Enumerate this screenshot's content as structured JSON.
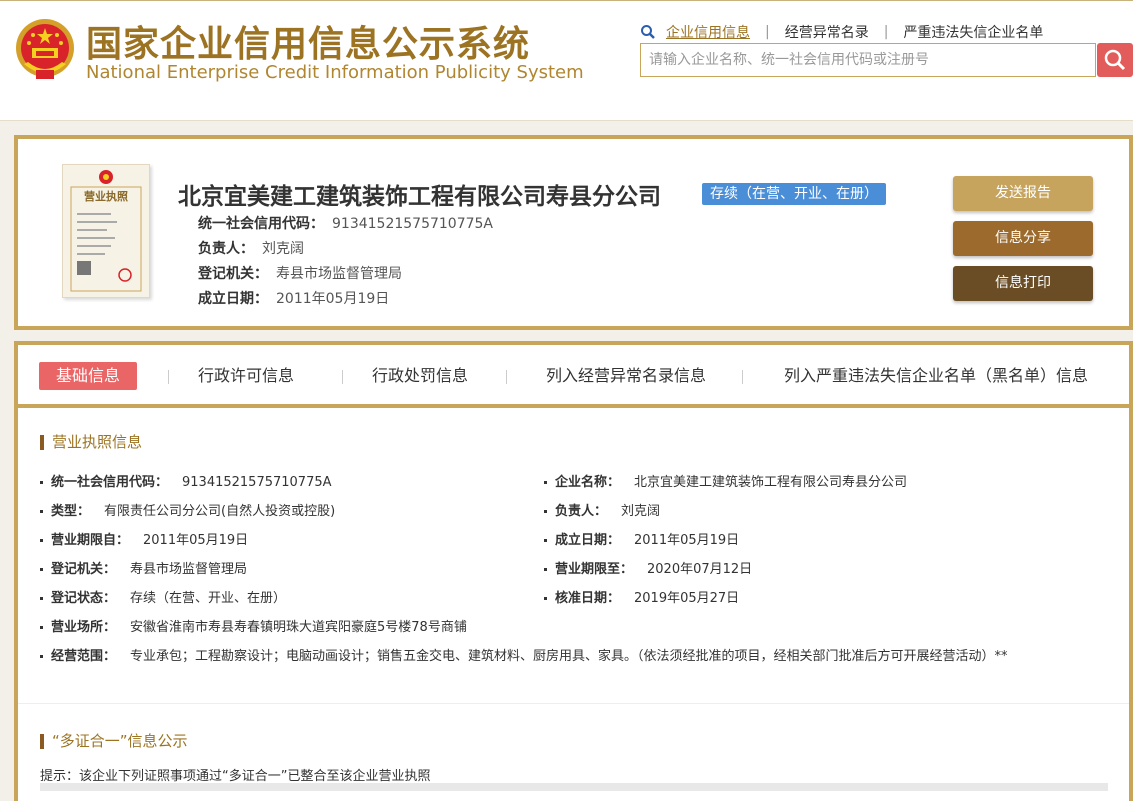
{
  "header": {
    "title_cn": "国家企业信用信息公示系统",
    "title_en": "National Enterprise Credit Information Publicity System",
    "links": [
      "企业信用信息",
      "经营异常名录",
      "严重违法失信企业名单"
    ],
    "search_placeholder": "请输入企业名称、统一社会信用代码或注册号",
    "colors": {
      "brand": "#9c7322",
      "search_button": "#e35c5c"
    }
  },
  "company": {
    "name": "北京宜美建工建筑装饰工程有限公司寿县分公司",
    "status": "存续（在营、开业、在册）",
    "fields": [
      {
        "label": "统一社会信用代码：",
        "value": "91341521575710775A"
      },
      {
        "label": "负责人：",
        "value": "刘克阔"
      },
      {
        "label": "登记机关：",
        "value": "寿县市场监督管理局"
      },
      {
        "label": "成立日期：",
        "value": "2011年05月19日"
      }
    ],
    "license_icon_label": "营业执照",
    "buttons": {
      "send_report": "发送报告",
      "share": "信息分享",
      "print": "信息打印"
    }
  },
  "tabs": [
    "基础信息",
    "行政许可信息",
    "行政处罚信息",
    "列入经营异常名录信息",
    "列入严重违法失信企业名单（黑名单）信息"
  ],
  "license_section": {
    "title": "营业执照信息",
    "left": [
      {
        "label": "统一社会信用代码：",
        "value": "91341521575710775A"
      },
      {
        "label": "类型：",
        "value": "有限责任公司分公司(自然人投资或控股)"
      },
      {
        "label": "营业期限自：",
        "value": "2011年05月19日"
      },
      {
        "label": "登记机关：",
        "value": "寿县市场监督管理局"
      },
      {
        "label": "登记状态：",
        "value": "存续（在营、开业、在册）"
      }
    ],
    "right": [
      {
        "label": "企业名称：",
        "value": "北京宜美建工建筑装饰工程有限公司寿县分公司"
      },
      {
        "label": "负责人：",
        "value": "刘克阔"
      },
      {
        "label": "成立日期：",
        "value": "2011年05月19日"
      },
      {
        "label": "营业期限至：",
        "value": "2020年07月12日"
      },
      {
        "label": "核准日期：",
        "value": "2019年05月27日"
      }
    ],
    "address": {
      "label": "营业场所：",
      "value": "安徽省淮南市寿县寿春镇明珠大道宾阳豪庭5号楼78号商铺"
    },
    "scope": {
      "label": "经营范围：",
      "value": "专业承包；工程勘察设计；电脑动画设计；销售五金交电、建筑材料、厨房用具、家具。（依法须经批准的项目，经相关部门批准后方可开展经营活动）**"
    }
  },
  "multi_cert": {
    "title": "“多证合一”信息公示",
    "hint": "提示：该企业下列证照事项通过“多证合一”已整合至该企业营业执照"
  }
}
